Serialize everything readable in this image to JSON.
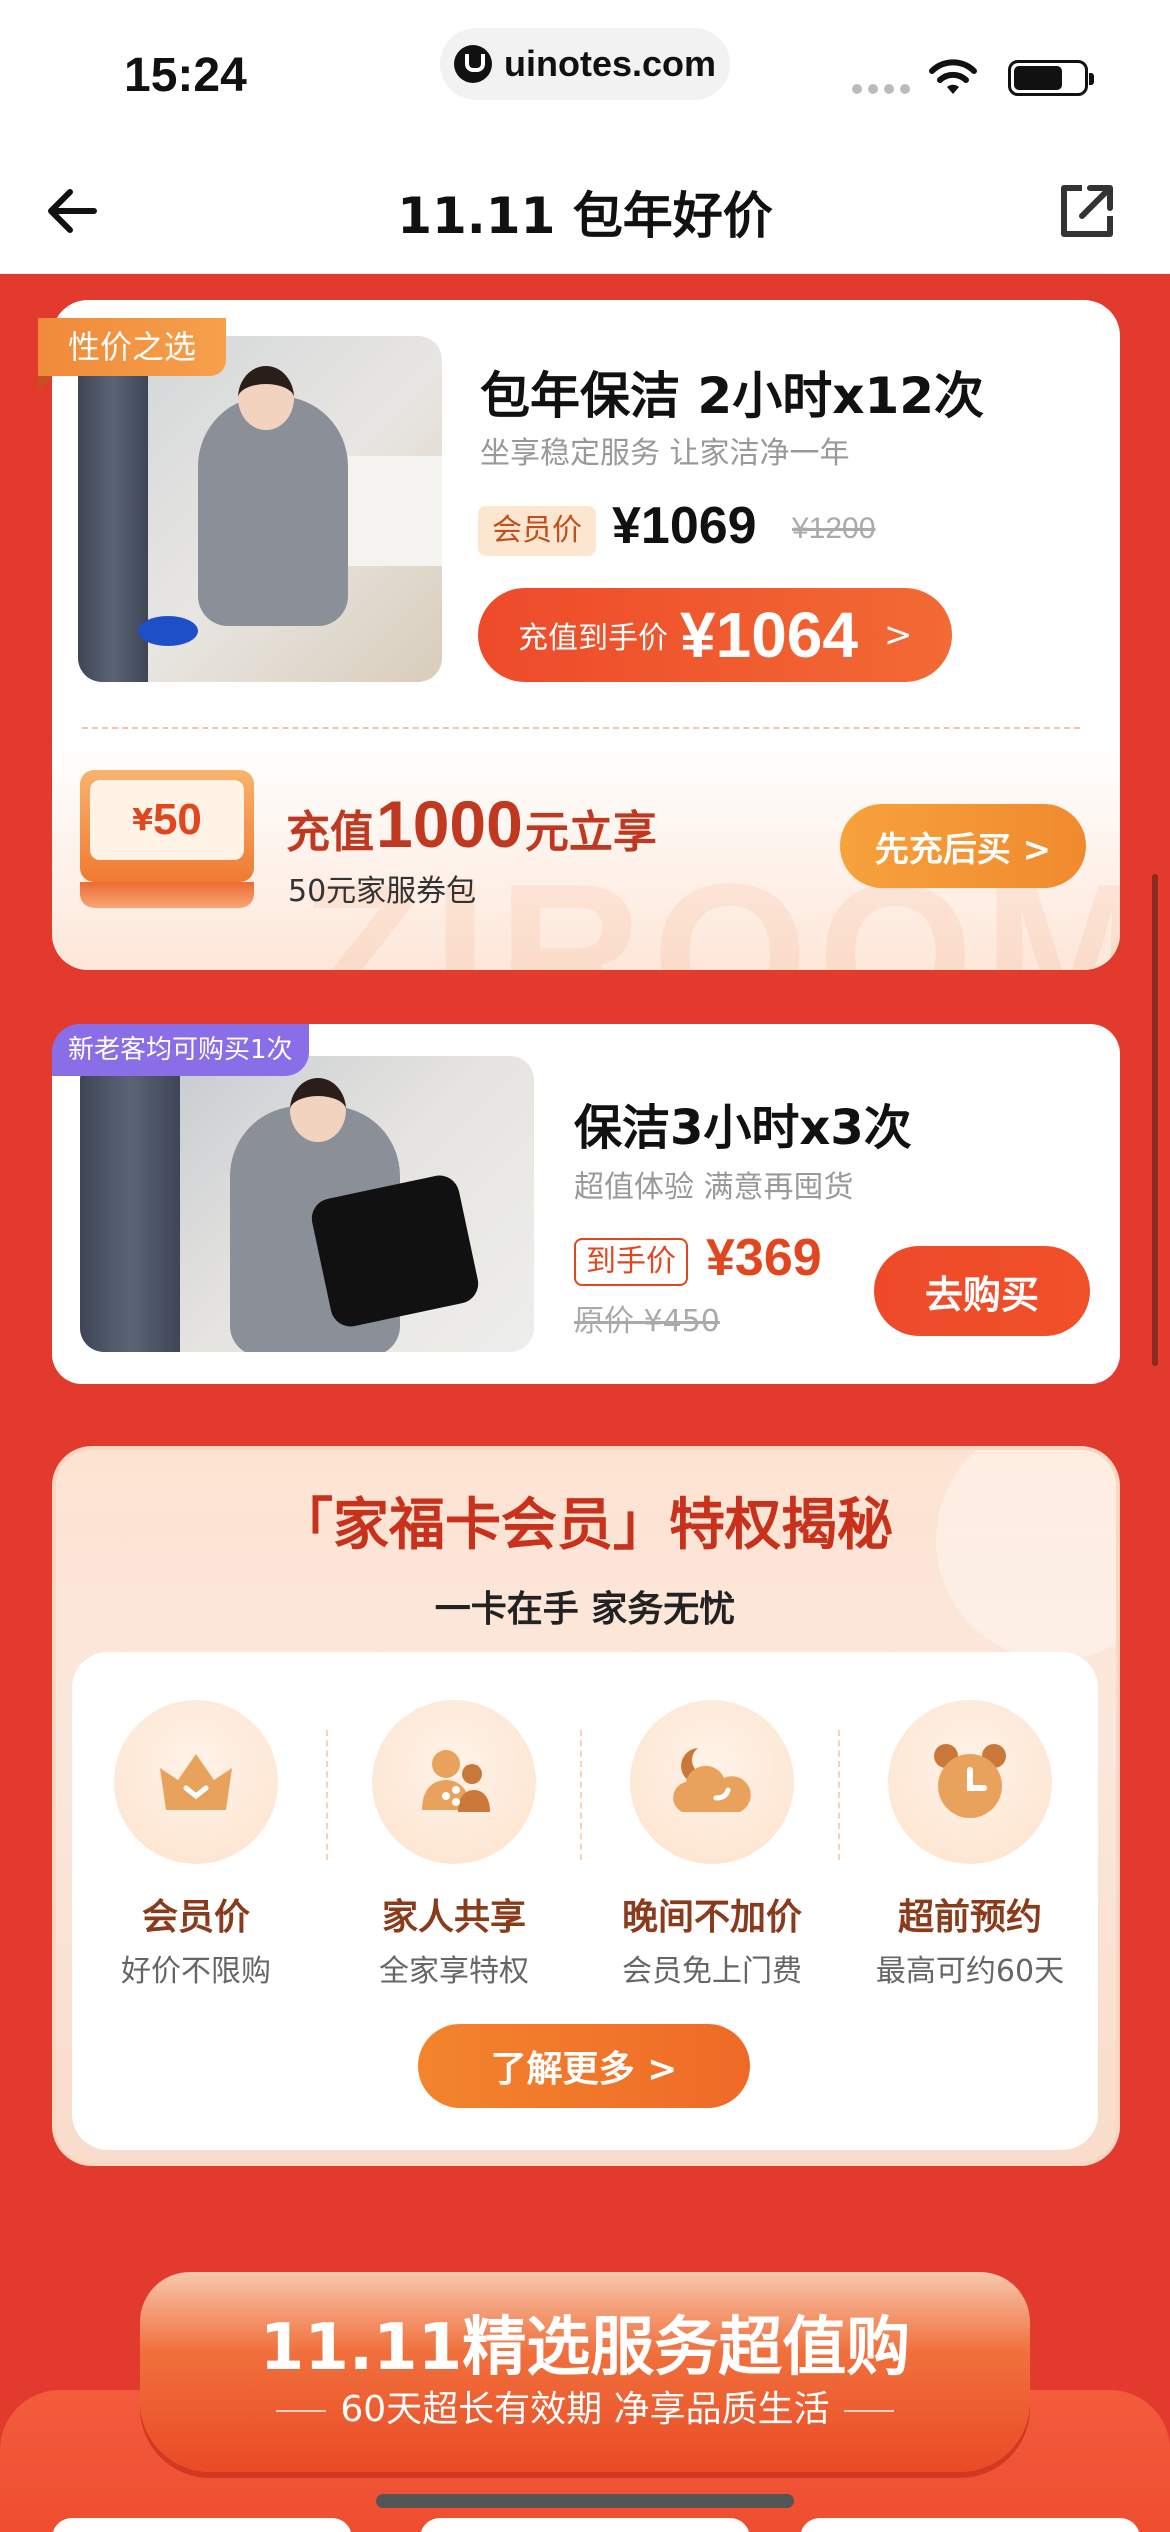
{
  "status_bar": {
    "time": "15:24",
    "url": "uinotes.com"
  },
  "nav": {
    "title": "11.11 包年好价"
  },
  "card1": {
    "tag": "性价之选",
    "title": "包年保洁 2小时x12次",
    "subtitle": "坐享稳定服务 让家洁净一年",
    "member_tag": "会员价",
    "price": "¥1069",
    "old_price": "¥1200",
    "button_label": "充值到手价",
    "button_amount": "¥1064",
    "button_chevron": ">",
    "coupon_currency": "¥",
    "coupon_amount": "50",
    "promo_prefix": "充值",
    "promo_amount": "1000",
    "promo_suffix": "元立享",
    "promo_sub": "50元家服券包",
    "charge_button": "先充后买 >",
    "watermark": "ZIROOM"
  },
  "card2": {
    "tag": "新老客均可购买1次",
    "title": "保洁3小时x3次",
    "subtitle": "超值体验 满意再囤货",
    "hand_tag": "到手价",
    "price": "¥369",
    "old_price": "原价 ¥450",
    "buy_button": "去购买"
  },
  "member_card": {
    "title": "「家福卡会员」特权揭秘",
    "subtitle": "一卡在手 家务无忧",
    "benefits": [
      {
        "name": "会员价",
        "desc": "好价不限购",
        "icon": "crown-icon"
      },
      {
        "name": "家人共享",
        "desc": "全家享特权",
        "icon": "family-share-icon"
      },
      {
        "name": "晚间不加价",
        "desc": "会员免上门费",
        "icon": "moon-cloud-icon"
      },
      {
        "name": "超前预约",
        "desc": "最高可约60天",
        "icon": "alarm-clock-icon"
      }
    ],
    "more_button": "了解更多 >"
  },
  "banner": {
    "title": "11.11精选服务超值购",
    "subtitle": "60天超长有效期 净享品质生活"
  },
  "colors": {
    "background": "#e23b2e",
    "accent": "#ee4a2a",
    "orange": "#f08a3a",
    "purple": "#8a6ee8"
  }
}
